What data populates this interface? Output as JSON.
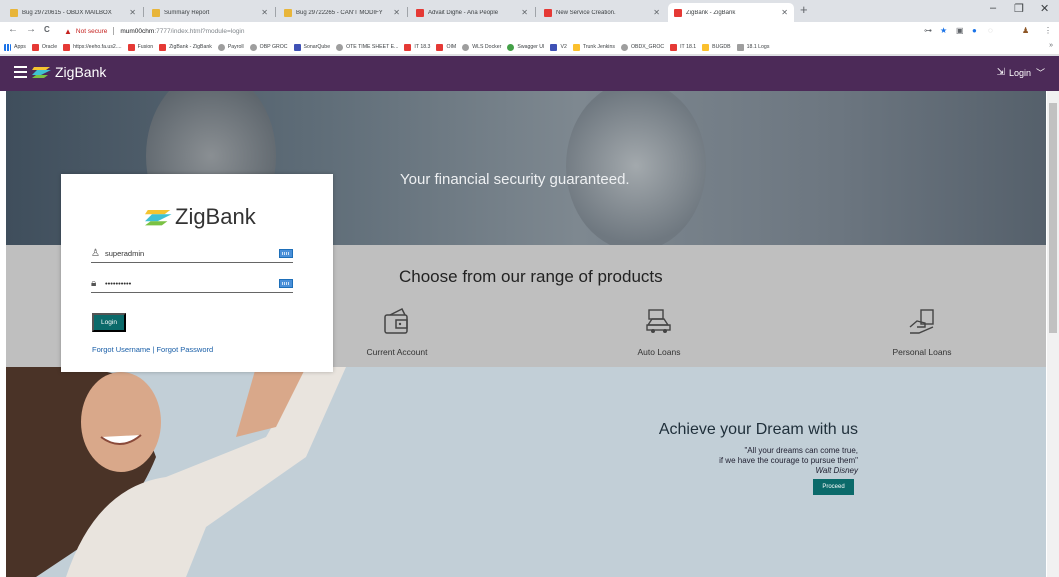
{
  "browser": {
    "tabs": [
      {
        "title": "Bug 29720615 - OBDX MAILBOX",
        "icon": "bugzilla-icon"
      },
      {
        "title": "Summary Report",
        "icon": "bugzilla-icon"
      },
      {
        "title": "Bug 29722265 - CAN'T MODIFY",
        "icon": "bugzilla-icon"
      },
      {
        "title": "Advait Dighe - Aria People",
        "icon": "oracle-icon"
      },
      {
        "title": "New Service Creation.",
        "icon": "oracle-icon"
      },
      {
        "title": "ZigBank - ZigBank",
        "icon": "oracle-icon"
      }
    ],
    "new_tab": "+",
    "window_controls": [
      "–",
      "❐",
      "✕"
    ],
    "nav": {
      "back": "←",
      "forward": "→",
      "reload": "C"
    },
    "security_label": "Not secure",
    "url_host": "mum00chm",
    "url_path": ":7777/index.html?module=login",
    "bookmarks": [
      {
        "label": "Apps",
        "icon": "apps-grid-icon"
      },
      {
        "label": "Oracle",
        "icon": "oracle-icon"
      },
      {
        "label": "https://eeho.fa.us2....",
        "icon": "oracle-icon"
      },
      {
        "label": "Fusion",
        "icon": "oracle-icon"
      },
      {
        "label": "ZigBank - ZigBank",
        "icon": "oracle-icon"
      },
      {
        "label": "Payroll",
        "icon": "globe-icon"
      },
      {
        "label": "OBP GROC",
        "icon": "bracket-icon"
      },
      {
        "label": "SonarQube",
        "icon": "sonarqube-icon"
      },
      {
        "label": "OTE TIME SHEET E...",
        "icon": "globe-icon"
      },
      {
        "label": "IT 18.3",
        "icon": "oracle-icon"
      },
      {
        "label": "OIM",
        "icon": "oracle-icon"
      },
      {
        "label": "WLS Docker",
        "icon": "globe-icon"
      },
      {
        "label": "Swagger UI",
        "icon": "swagger-icon"
      },
      {
        "label": "V2",
        "icon": "x-icon"
      },
      {
        "label": "Trunk Jenkins",
        "icon": "jenkins-icon"
      },
      {
        "label": "OBDX_GROC",
        "icon": "bracket-icon"
      },
      {
        "label": "IT 18.1",
        "icon": "oracle-icon"
      },
      {
        "label": "BUGDB",
        "icon": "bugzilla-icon"
      },
      {
        "label": "18.1 Logs",
        "icon": "logs-icon"
      }
    ],
    "bookmarks_more": "»"
  },
  "app": {
    "brand": "ZigBank",
    "header_login": "Login",
    "hero_text": "Your financial security guaranteed.",
    "products_title": "Choose from our range of products",
    "products": [
      {
        "label": "Current Account",
        "icon": "current-account-icon"
      },
      {
        "label": "Auto Loans",
        "icon": "auto-loans-icon"
      },
      {
        "label": "Personal Loans",
        "icon": "personal-loans-icon"
      }
    ],
    "dream_title": "Achieve your Dream with us",
    "quote_line1": "\"All your dreams can come true,",
    "quote_line2": "if we have the courage to pursue them\"",
    "quote_author": "Walt Disney",
    "proceed_label": "Proceed",
    "login_card": {
      "logo": "ZigBank",
      "username_value": "superadmin",
      "password_value": "••••••••••",
      "login_button": "Login",
      "forgot_text": "Forgot Username | Forgot Password"
    }
  },
  "colors": {
    "header_bg": "#4c2a58",
    "primary_button": "#0b6a6a",
    "link": "#1a5fa8"
  }
}
